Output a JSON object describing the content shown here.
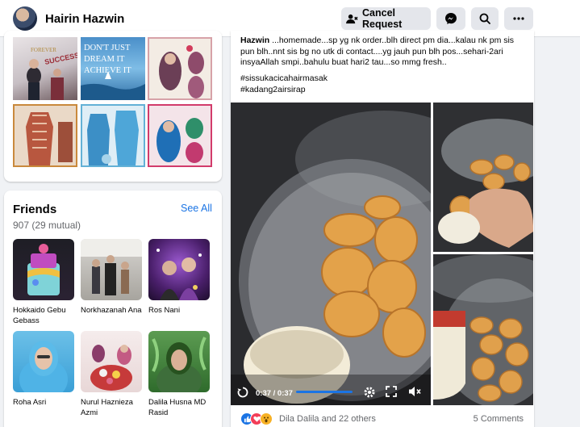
{
  "header": {
    "profile_name": "Hairin Hazwin",
    "cancel_request_label": "Cancel Request",
    "icons": [
      "friend-request-icon",
      "messenger-icon",
      "search-icon",
      "more-icon"
    ]
  },
  "photos": {
    "banner_words": [
      "FOREVER",
      "SUCCESS DAY",
      "DON'T JUST",
      "DREAM IT",
      "ACHIEVE IT"
    ]
  },
  "friends": {
    "title": "Friends",
    "count": "907 (29 mutual)",
    "see_all": "See All",
    "items": [
      {
        "name": "Hokkaido Gebu Gebass"
      },
      {
        "name": "Norkhazanah Ana"
      },
      {
        "name": "Ros Nani"
      },
      {
        "name": "Roha Asri"
      },
      {
        "name": "Nurul Haznieza Azmi"
      },
      {
        "name": "Dalila Husna MD Rasid"
      }
    ]
  },
  "post": {
    "author": "Hazwin",
    "text": " ...homemade...sp yg nk order..blh direct pm dia...kalau nk pm sis pun blh..nnt sis bg no utk di contact....yg jauh pun blh pos...sehari-2ari insyaAllah smpi..bahulu buat hari2 tau...so mmg fresh..",
    "hashtag1": "#sissukacicahairmasak",
    "hashtag2": "#kadang2airsirap",
    "video_time": "0:37 / 0:37",
    "video_progress": 1.0,
    "reactions_names": "Dila Dalila and 22 others",
    "comments": "5 Comments",
    "reaction_icons": [
      "like-icon",
      "love-icon",
      "wow-icon"
    ]
  }
}
